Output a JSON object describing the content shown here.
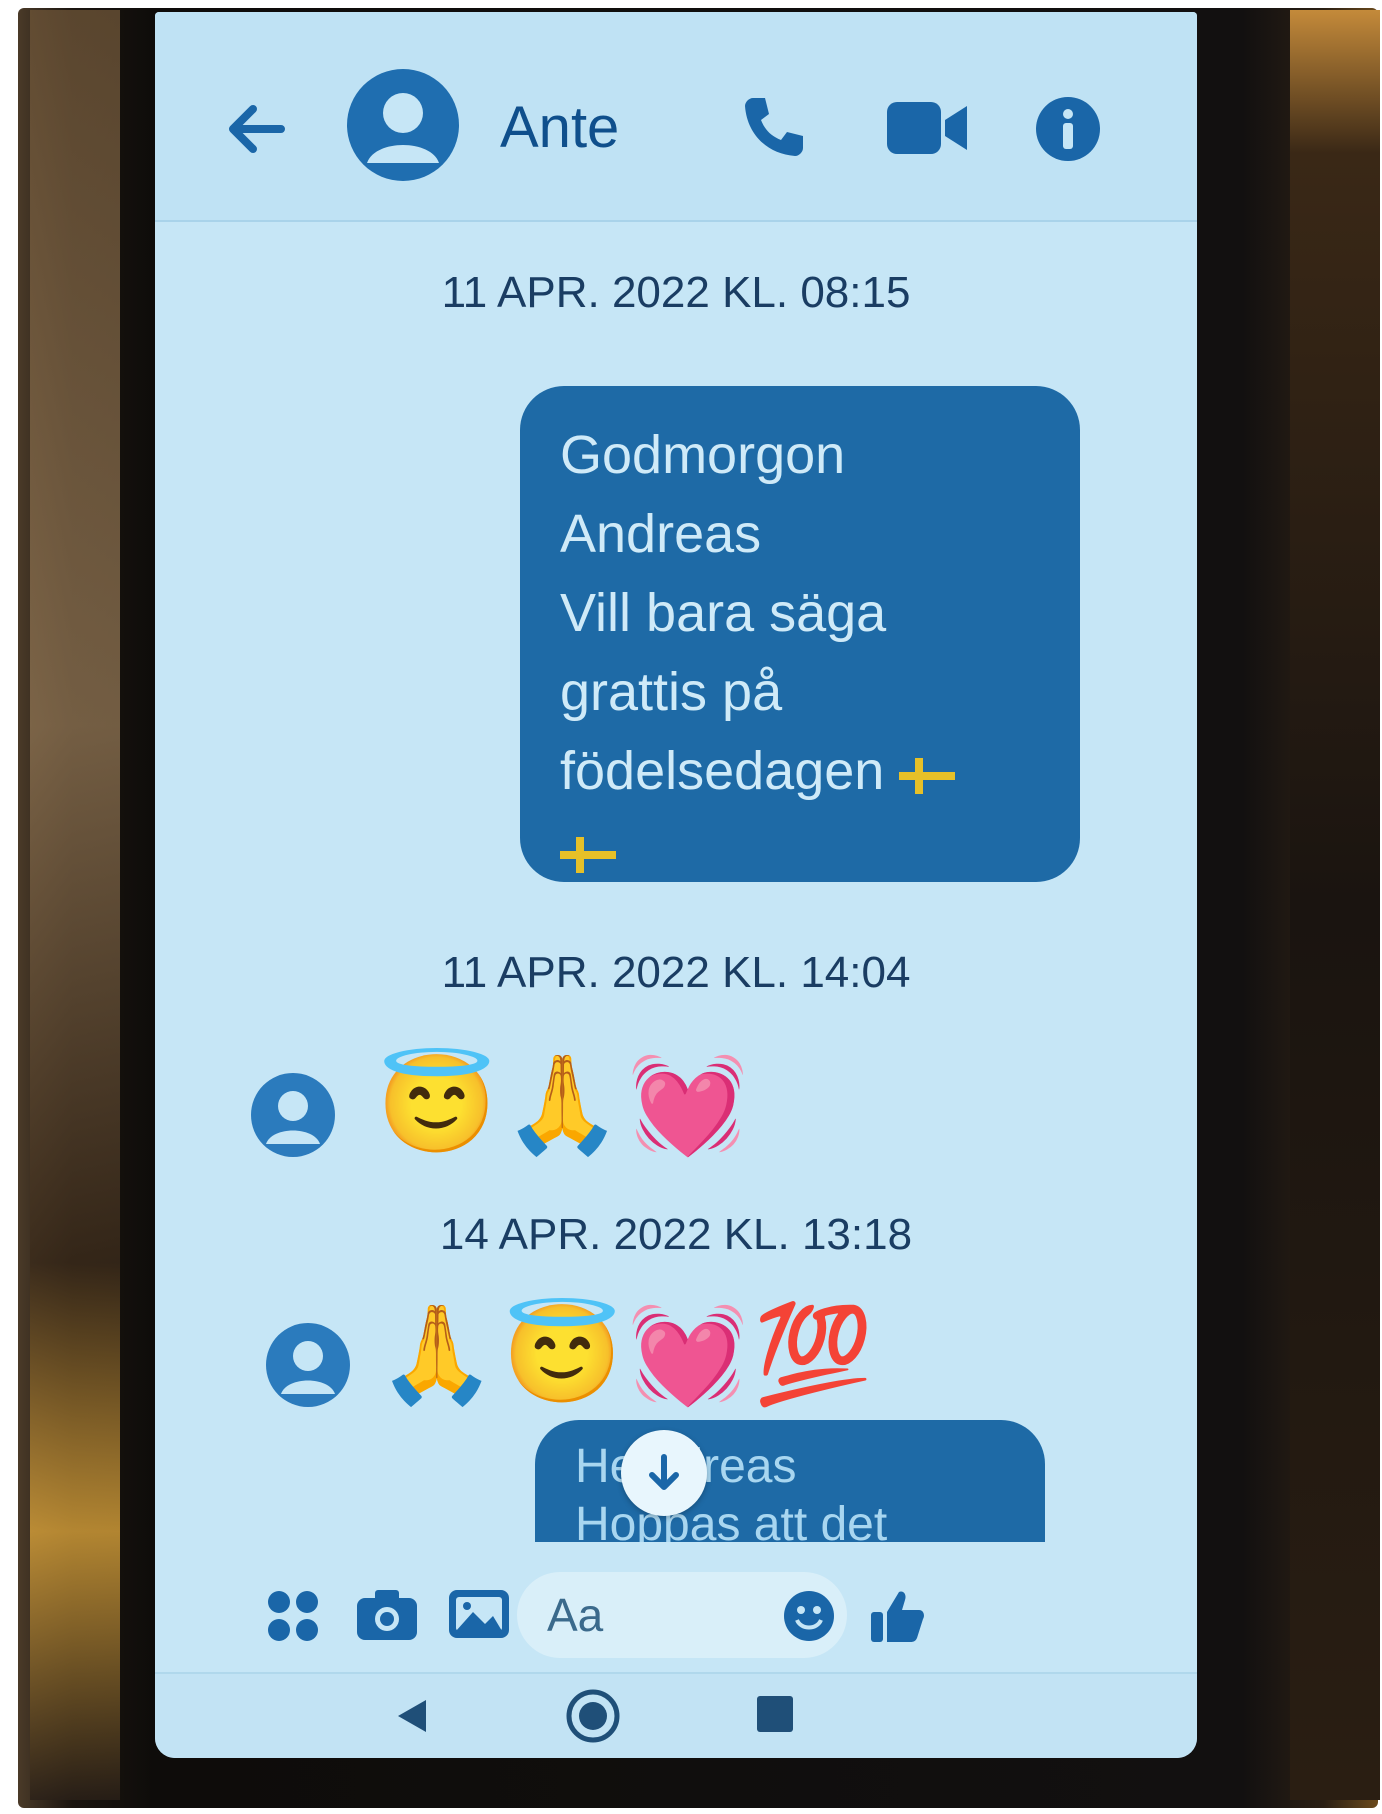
{
  "header": {
    "contact_name": "Ante",
    "icons": [
      "back-arrow-icon",
      "profile-avatar-icon",
      "phone-call-icon",
      "video-call-icon",
      "info-icon"
    ]
  },
  "messages": [
    {
      "timestamp": "11 APR. 2022 KL. 08:15",
      "direction": "outgoing",
      "lines": [
        "Godmorgon",
        "Andreas",
        "Vill bara säga",
        "grattis på",
        "födelsedagen"
      ],
      "trailing_emoji": [
        "swedish-flag",
        "swedish-flag"
      ]
    },
    {
      "timestamp": "11 APR. 2022 KL. 14:04",
      "direction": "incoming",
      "emojis": [
        "😇",
        "🙏",
        "💓"
      ]
    },
    {
      "timestamp": "14 APR. 2022 KL. 13:18",
      "direction": "incoming",
      "emojis": [
        "🙏",
        "😇",
        "💓",
        "💯"
      ]
    },
    {
      "direction": "outgoing",
      "partial": true,
      "lines": [
        "He  ndreas",
        "Hoppas att det"
      ]
    }
  ],
  "composer": {
    "placeholder": "Aa",
    "icons": [
      "more-apps-icon",
      "camera-icon",
      "gallery-icon",
      "emoji-icon",
      "thumbs-up-icon"
    ]
  },
  "colors": {
    "screen_bg": "#c6e6f6",
    "bubble_outgoing": "#1e6aa6",
    "accent": "#1a66a8",
    "text_dark": "#1a3d63"
  }
}
